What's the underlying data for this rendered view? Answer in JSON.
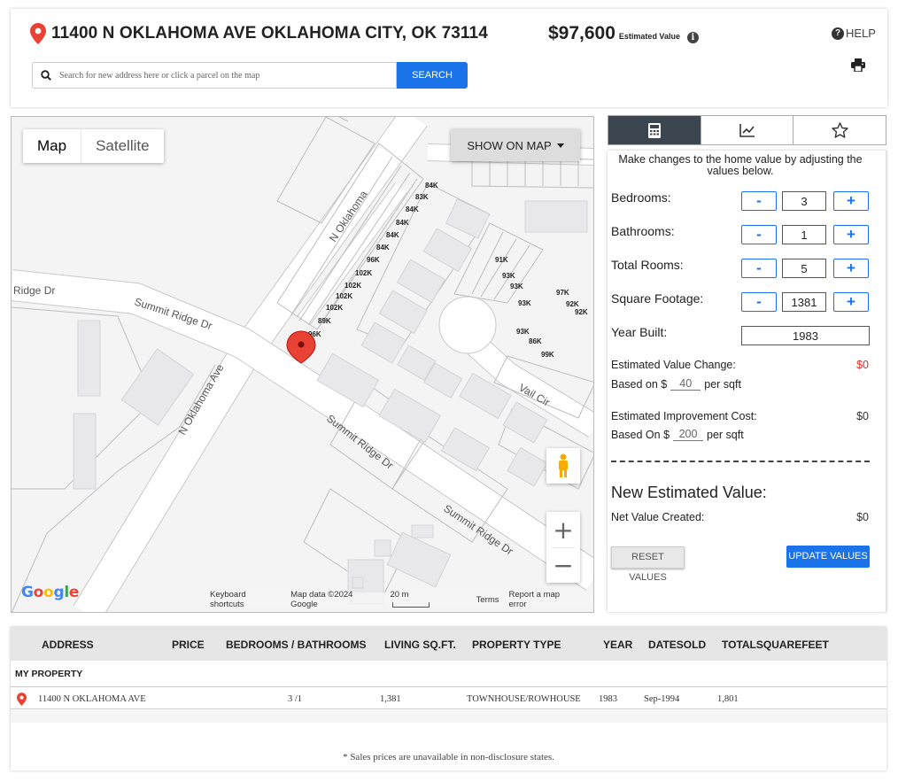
{
  "header": {
    "address": "11400 N OKLAHOMA AVE OKLAHOMA CITY, OK 73114",
    "estimated_value": "$97,600",
    "estimated_value_label": "Estimated Value",
    "help_label": "HELP",
    "search_placeholder": "Search for new address here or click a parcel on the map",
    "search_button": "SEARCH"
  },
  "map": {
    "type_options": [
      "Map",
      "Satellite"
    ],
    "selected_type": "Map",
    "show_on_map_label": "SHOW ON MAP",
    "roads": [
      "N Oklahoma",
      "Ridge Dr",
      "Summit Ridge Dr",
      "N Oklahoma Ave",
      "Summit Ridge Dr",
      "Summit Ridge Dr",
      "Vail Cir"
    ],
    "parcel_prices_left": [
      "84K",
      "83K",
      "84K",
      "84K",
      "84K",
      "84K",
      "96K",
      "102K",
      "102K",
      "102K",
      "102K",
      "89K",
      "96K"
    ],
    "parcel_prices_right": [
      "91K",
      "93K",
      "93K",
      "93K",
      "97K",
      "92K",
      "92K",
      "93K",
      "86K",
      "99K"
    ],
    "footer": {
      "keyboard_shortcuts": "Keyboard shortcuts",
      "map_data": "Map data ©2024 Google",
      "scale": "20 m",
      "terms": "Terms",
      "report": "Report a map error"
    },
    "google_logo": "Google"
  },
  "panel": {
    "intro": "Make changes to the home value by adjusting the values below.",
    "bedrooms_label": "Bedrooms:",
    "bedrooms_value": "3",
    "bathrooms_label": "Bathrooms:",
    "bathrooms_value": "1",
    "total_rooms_label": "Total Rooms:",
    "total_rooms_value": "5",
    "sqft_label": "Square Footage:",
    "sqft_value": "1381",
    "year_built_label": "Year Built:",
    "year_built_value": "1983",
    "minus": "-",
    "plus": "+",
    "est_value_change_label": "Estimated Value Change:",
    "est_value_change": "$0",
    "based_on_label": "Based on $",
    "based_on_value": "40",
    "per_sqft": "per sqft",
    "est_improvement_label": "Estimated Improvement Cost:",
    "est_improvement": "$0",
    "based_on_label2": "Based On $",
    "based_on_value2": "200",
    "new_est_value_label": "New Estimated Value:",
    "net_value_label": "Net Value Created:",
    "net_value": "$0",
    "reset_button": "RESET VALUES",
    "update_button": "UPDATE VALUES"
  },
  "table": {
    "columns": [
      "ADDRESS",
      "PRICE",
      "BEDROOMS / BATHROOMS",
      "LIVING SQ.FT.",
      "PROPERTY TYPE",
      "YEAR",
      "DATESOLD",
      "TOTALSQUAREFEET"
    ],
    "group_label": "MY PROPERTY",
    "rows": [
      {
        "address": "11400 N OKLAHOMA AVE",
        "price": "",
        "bed_bath": "3 /1",
        "living_sqft": "1,381",
        "property_type": "TOWNHOUSE/ROWHOUSE",
        "year": "1983",
        "date_sold": "Sep-1994",
        "total_sqft": "1,801"
      }
    ],
    "footnote": "* Sales prices are unavailable in non-disclosure states."
  },
  "colors": {
    "accent": "#1a73e8",
    "pin": "#e94235",
    "negative": "#d93025",
    "tab_active": "#3a4550"
  }
}
